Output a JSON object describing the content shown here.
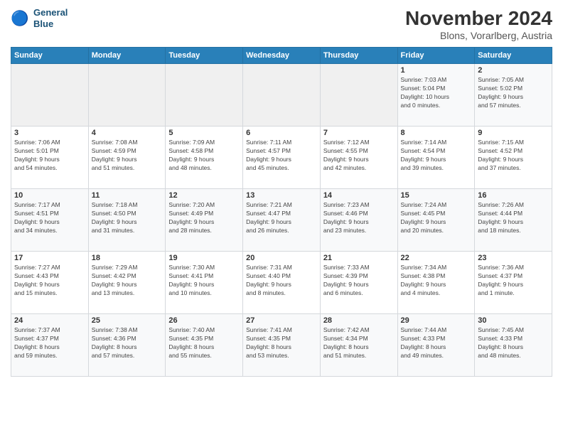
{
  "header": {
    "logo_line1": "General",
    "logo_line2": "Blue",
    "month": "November 2024",
    "location": "Blons, Vorarlberg, Austria"
  },
  "days_of_week": [
    "Sunday",
    "Monday",
    "Tuesday",
    "Wednesday",
    "Thursday",
    "Friday",
    "Saturday"
  ],
  "weeks": [
    [
      {
        "day": "",
        "info": ""
      },
      {
        "day": "",
        "info": ""
      },
      {
        "day": "",
        "info": ""
      },
      {
        "day": "",
        "info": ""
      },
      {
        "day": "",
        "info": ""
      },
      {
        "day": "1",
        "info": "Sunrise: 7:03 AM\nSunset: 5:04 PM\nDaylight: 10 hours\nand 0 minutes."
      },
      {
        "day": "2",
        "info": "Sunrise: 7:05 AM\nSunset: 5:02 PM\nDaylight: 9 hours\nand 57 minutes."
      }
    ],
    [
      {
        "day": "3",
        "info": "Sunrise: 7:06 AM\nSunset: 5:01 PM\nDaylight: 9 hours\nand 54 minutes."
      },
      {
        "day": "4",
        "info": "Sunrise: 7:08 AM\nSunset: 4:59 PM\nDaylight: 9 hours\nand 51 minutes."
      },
      {
        "day": "5",
        "info": "Sunrise: 7:09 AM\nSunset: 4:58 PM\nDaylight: 9 hours\nand 48 minutes."
      },
      {
        "day": "6",
        "info": "Sunrise: 7:11 AM\nSunset: 4:57 PM\nDaylight: 9 hours\nand 45 minutes."
      },
      {
        "day": "7",
        "info": "Sunrise: 7:12 AM\nSunset: 4:55 PM\nDaylight: 9 hours\nand 42 minutes."
      },
      {
        "day": "8",
        "info": "Sunrise: 7:14 AM\nSunset: 4:54 PM\nDaylight: 9 hours\nand 39 minutes."
      },
      {
        "day": "9",
        "info": "Sunrise: 7:15 AM\nSunset: 4:52 PM\nDaylight: 9 hours\nand 37 minutes."
      }
    ],
    [
      {
        "day": "10",
        "info": "Sunrise: 7:17 AM\nSunset: 4:51 PM\nDaylight: 9 hours\nand 34 minutes."
      },
      {
        "day": "11",
        "info": "Sunrise: 7:18 AM\nSunset: 4:50 PM\nDaylight: 9 hours\nand 31 minutes."
      },
      {
        "day": "12",
        "info": "Sunrise: 7:20 AM\nSunset: 4:49 PM\nDaylight: 9 hours\nand 28 minutes."
      },
      {
        "day": "13",
        "info": "Sunrise: 7:21 AM\nSunset: 4:47 PM\nDaylight: 9 hours\nand 26 minutes."
      },
      {
        "day": "14",
        "info": "Sunrise: 7:23 AM\nSunset: 4:46 PM\nDaylight: 9 hours\nand 23 minutes."
      },
      {
        "day": "15",
        "info": "Sunrise: 7:24 AM\nSunset: 4:45 PM\nDaylight: 9 hours\nand 20 minutes."
      },
      {
        "day": "16",
        "info": "Sunrise: 7:26 AM\nSunset: 4:44 PM\nDaylight: 9 hours\nand 18 minutes."
      }
    ],
    [
      {
        "day": "17",
        "info": "Sunrise: 7:27 AM\nSunset: 4:43 PM\nDaylight: 9 hours\nand 15 minutes."
      },
      {
        "day": "18",
        "info": "Sunrise: 7:29 AM\nSunset: 4:42 PM\nDaylight: 9 hours\nand 13 minutes."
      },
      {
        "day": "19",
        "info": "Sunrise: 7:30 AM\nSunset: 4:41 PM\nDaylight: 9 hours\nand 10 minutes."
      },
      {
        "day": "20",
        "info": "Sunrise: 7:31 AM\nSunset: 4:40 PM\nDaylight: 9 hours\nand 8 minutes."
      },
      {
        "day": "21",
        "info": "Sunrise: 7:33 AM\nSunset: 4:39 PM\nDaylight: 9 hours\nand 6 minutes."
      },
      {
        "day": "22",
        "info": "Sunrise: 7:34 AM\nSunset: 4:38 PM\nDaylight: 9 hours\nand 4 minutes."
      },
      {
        "day": "23",
        "info": "Sunrise: 7:36 AM\nSunset: 4:37 PM\nDaylight: 9 hours\nand 1 minute."
      }
    ],
    [
      {
        "day": "24",
        "info": "Sunrise: 7:37 AM\nSunset: 4:37 PM\nDaylight: 8 hours\nand 59 minutes."
      },
      {
        "day": "25",
        "info": "Sunrise: 7:38 AM\nSunset: 4:36 PM\nDaylight: 8 hours\nand 57 minutes."
      },
      {
        "day": "26",
        "info": "Sunrise: 7:40 AM\nSunset: 4:35 PM\nDaylight: 8 hours\nand 55 minutes."
      },
      {
        "day": "27",
        "info": "Sunrise: 7:41 AM\nSunset: 4:35 PM\nDaylight: 8 hours\nand 53 minutes."
      },
      {
        "day": "28",
        "info": "Sunrise: 7:42 AM\nSunset: 4:34 PM\nDaylight: 8 hours\nand 51 minutes."
      },
      {
        "day": "29",
        "info": "Sunrise: 7:44 AM\nSunset: 4:33 PM\nDaylight: 8 hours\nand 49 minutes."
      },
      {
        "day": "30",
        "info": "Sunrise: 7:45 AM\nSunset: 4:33 PM\nDaylight: 8 hours\nand 48 minutes."
      }
    ]
  ]
}
